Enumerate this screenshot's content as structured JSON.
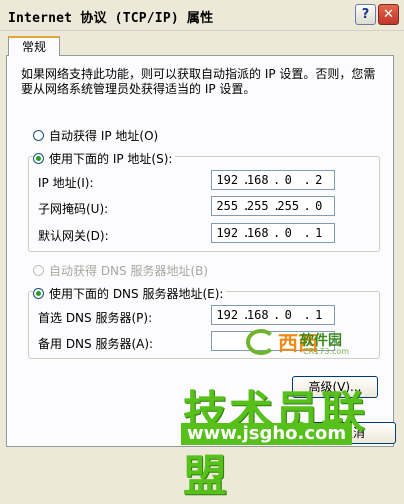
{
  "window": {
    "title": "Internet 协议 (TCP/IP) 属性",
    "help_glyph": "?",
    "close_glyph": "✕"
  },
  "tab": {
    "label": "常规"
  },
  "description": "如果网络支持此功能，则可以获取自动指派的 IP 设置。否则，您需要从网络系统管理员处获得适当的 IP 设置。",
  "ip_section": {
    "auto_label": "自动获得 IP 地址(O)",
    "manual_label": "使用下面的 IP 地址(S):",
    "selected": "manual",
    "fields": [
      {
        "label": "IP 地址(I):",
        "octets": [
          "192",
          "168",
          "0",
          "2"
        ]
      },
      {
        "label": "子网掩码(U):",
        "octets": [
          "255",
          "255",
          "255",
          "0"
        ]
      },
      {
        "label": "默认网关(D):",
        "octets": [
          "192",
          "168",
          "0",
          "1"
        ]
      }
    ]
  },
  "dns_section": {
    "auto_label": "自动获得 DNS 服务器地址(B)",
    "manual_label": "使用下面的 DNS 服务器地址(E):",
    "selected": "manual",
    "fields": [
      {
        "label": "首选 DNS 服务器(P):",
        "octets": [
          "192",
          "168",
          "0",
          "1"
        ]
      },
      {
        "label": "备用 DNS 服务器(A):",
        "octets": [
          "",
          "",
          "",
          ""
        ]
      }
    ]
  },
  "buttons": {
    "advanced": "高级(V)...",
    "cancel": "取消"
  },
  "watermark": {
    "logo_text": "西西",
    "logo_sub": "软件园",
    "logo_small": "CR173.com",
    "big_text": "技术员联盟",
    "url": "www.jsgho.com"
  },
  "colors": {
    "accent_tab": "#e6a43a",
    "radio_selected": "#21a121",
    "watermark_green": "#57c01a"
  }
}
